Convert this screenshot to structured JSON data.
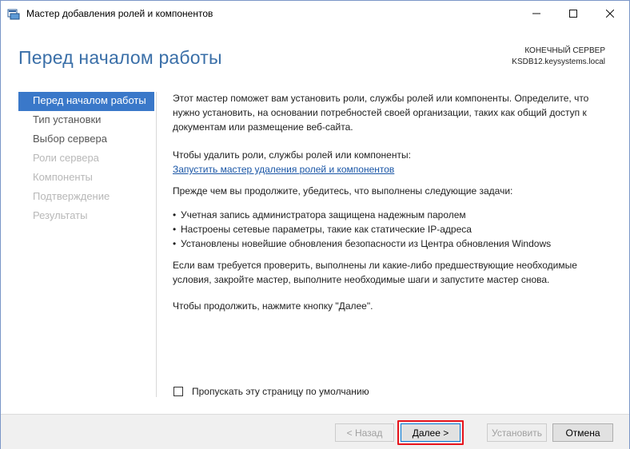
{
  "window": {
    "title": "Мастер добавления ролей и компонентов"
  },
  "header": {
    "page_title": "Перед началом работы",
    "server_label": "КОНЕЧНЫЙ СЕРВЕР",
    "server_name": "KSDB12.keysystems.local"
  },
  "sidebar": {
    "items": [
      {
        "label": "Перед началом работы",
        "state": "active"
      },
      {
        "label": "Тип установки",
        "state": "enabled"
      },
      {
        "label": "Выбор сервера",
        "state": "enabled"
      },
      {
        "label": "Роли сервера",
        "state": "disabled"
      },
      {
        "label": "Компоненты",
        "state": "disabled"
      },
      {
        "label": "Подтверждение",
        "state": "disabled"
      },
      {
        "label": "Результаты",
        "state": "disabled"
      }
    ]
  },
  "content": {
    "intro": "Этот мастер поможет вам установить роли, службы ролей или компоненты. Определите, что нужно установить, на основании потребностей своей организации, таких как общий доступ к документам или размещение веб-сайта.",
    "remove_label": "Чтобы удалить роли, службы ролей или компоненты:",
    "remove_link": "Запустить мастер удаления ролей и компонентов",
    "before_label": "Прежде чем вы продолжите, убедитесь, что выполнены следующие задачи:",
    "tasks": [
      "Учетная запись администратора защищена надежным паролем",
      "Настроены сетевые параметры, такие как статические IP-адреса",
      "Установлены новейшие обновления безопасности из Центра обновления Windows"
    ],
    "prereq_note": "Если вам требуется проверить, выполнены ли какие-либо предшествующие необходимые условия, закройте мастер, выполните необходимые шаги и запустите мастер снова.",
    "continue_note": "Чтобы продолжить, нажмите кнопку \"Далее\"."
  },
  "skip_checkbox": {
    "label": "Пропускать эту страницу по умолчанию",
    "checked": false
  },
  "footer": {
    "back_label": "< Назад",
    "next_label": "Далее >",
    "install_label": "Установить",
    "cancel_label": "Отмена"
  },
  "colors": {
    "accent": "#3a78c9",
    "title_blue": "#3a6fa8",
    "highlight_red": "#e8141c"
  }
}
